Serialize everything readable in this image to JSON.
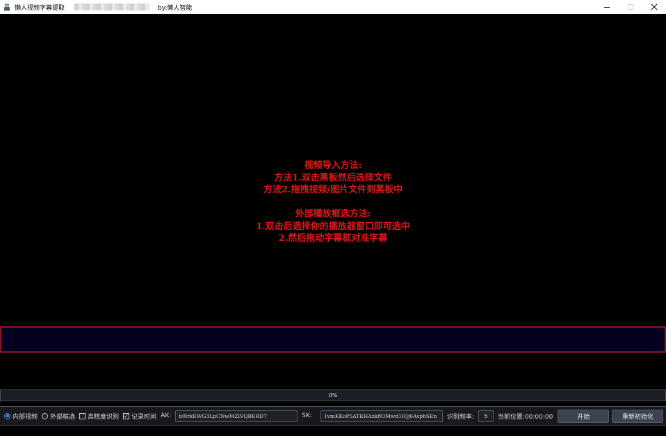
{
  "window": {
    "title": "懒人视频字幕提取",
    "author": "by:懒人智能",
    "controls": {
      "minimize": "—",
      "maximize": "☐",
      "close": "✕"
    }
  },
  "instructions": {
    "import_heading": "视频导入方法:",
    "import_method1": "方法1.双击黑板然后选择文件",
    "import_method2": "方法2.拖拽视频/图片文件到黑板中",
    "external_heading": "外部播放框选方法:",
    "external_step1": "1.双击后选择你的播放器窗口即可选中",
    "external_step2": "2.然后拖动字幕框对准字幕"
  },
  "progress": {
    "value": 0,
    "text": "0%"
  },
  "toolbar": {
    "internal_video_label": "内部视频",
    "internal_video_selected": true,
    "external_select_label": "外部框选",
    "external_select_selected": false,
    "high_precision_label": "高精度识别",
    "high_precision_checked": false,
    "record_time_label": "记录时间",
    "record_time_checked": true,
    "ak_label": "AK:",
    "ak_value": "b0lrkEWG3LpCNwMZlVQBERD7",
    "sk_label": "SK:",
    "sk_value": "1vmKKoP5ATEHAzk8OMwd1IQj6AsphSEn",
    "frequency_label": "识别频率:",
    "frequency_value": "5",
    "position_label": "当前位置:00:00:00",
    "start_button": "开始",
    "reinit_button": "重新初始化"
  },
  "colors": {
    "instruction_text": "#e01818",
    "subtitle_border": "#8c1628",
    "subtitle_fill": "#05001f",
    "toolbar_bg": "#17191d",
    "accent": "#4a90e8"
  }
}
